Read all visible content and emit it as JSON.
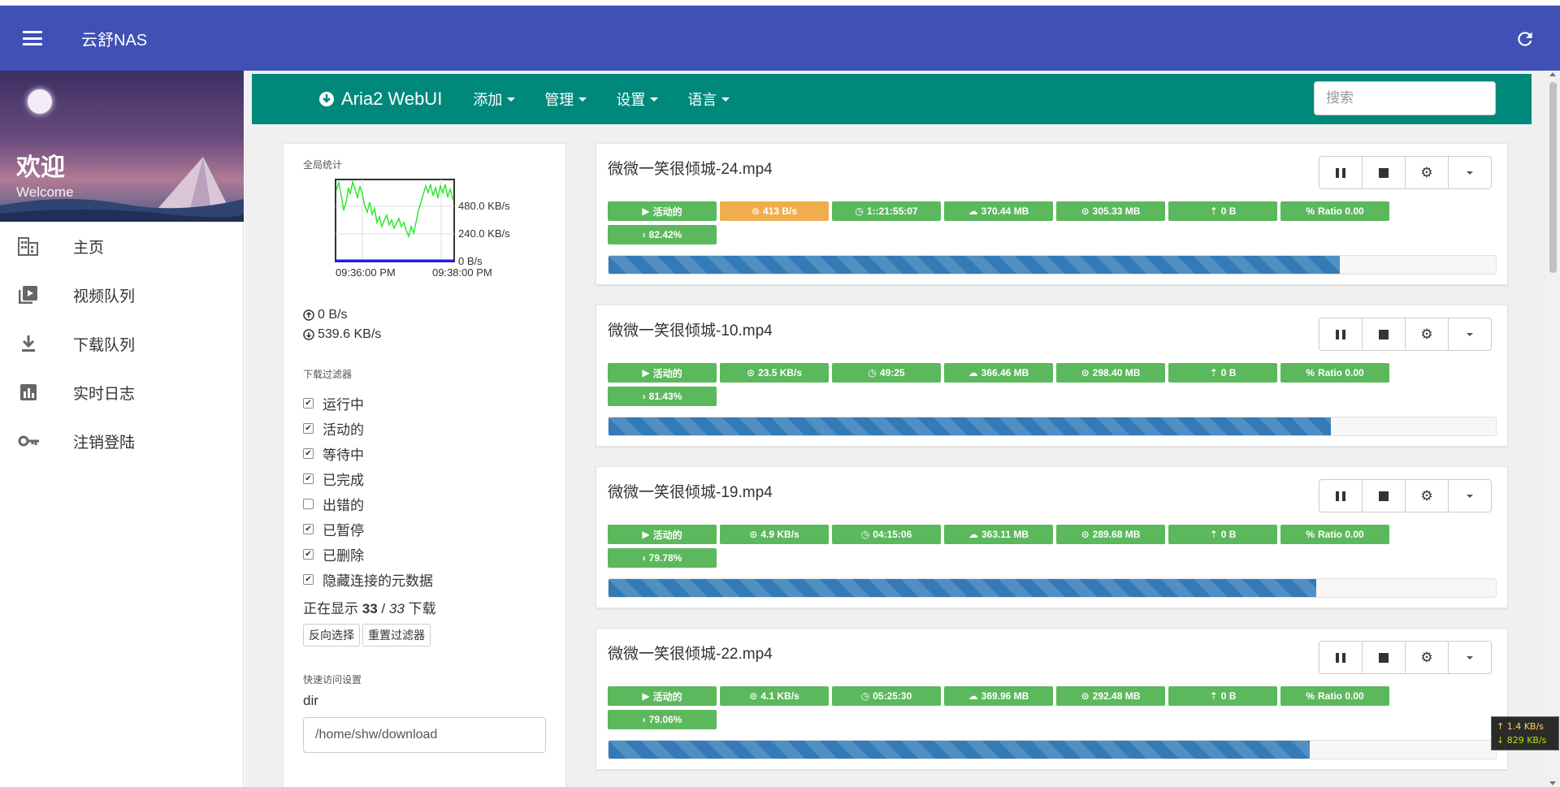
{
  "app": {
    "title": "云舒NAS"
  },
  "drawer": {
    "welcome_cn": "欢迎",
    "welcome_en": "Welcome",
    "items": [
      {
        "label": "主页",
        "icon": "building-icon"
      },
      {
        "label": "视频队列",
        "icon": "video-queue-icon"
      },
      {
        "label": "下载队列",
        "icon": "download-icon"
      },
      {
        "label": "实时日志",
        "icon": "chart-icon"
      },
      {
        "label": "注销登陆",
        "icon": "key-icon"
      }
    ]
  },
  "topnav": {
    "brand": "Aria2 WebUI",
    "menu": [
      "添加",
      "管理",
      "设置",
      "语言"
    ],
    "search_placeholder": "搜索",
    "color": "#00897b"
  },
  "stats": {
    "title": "全局统计",
    "y_labels": [
      "480.0 KB/s",
      "240.0 KB/s",
      "0 B/s"
    ],
    "x_labels": [
      "09:36:00 PM",
      "09:38:00 PM"
    ],
    "upload": "0 B/s",
    "download": "539.6 KB/s",
    "filter_title": "下载过滤器",
    "filters": [
      {
        "label": "运行中",
        "checked": true
      },
      {
        "label": "活动的",
        "checked": true
      },
      {
        "label": "等待中",
        "checked": true
      },
      {
        "label": "已完成",
        "checked": true
      },
      {
        "label": "出错的",
        "checked": false
      },
      {
        "label": "已暂停",
        "checked": true
      },
      {
        "label": "已删除",
        "checked": true
      },
      {
        "label": "隐藏连接的元数据",
        "checked": true
      }
    ],
    "showing_prefix": "正在显示",
    "showing_count": "33",
    "showing_sep": "/",
    "showing_total": "33",
    "showing_suffix": "下载",
    "btn_invert": "反向选择",
    "btn_reset": "重置过滤器",
    "quick_title": "快速访问设置",
    "dir_label": "dir",
    "dir_value": "/home/shw/download"
  },
  "downloads": [
    {
      "name": "微微一笑很倾城-24.mp4",
      "status": "活动的",
      "speed": "413 B/s",
      "speed_warn": true,
      "eta": "1::21:55:07",
      "size": "370.44 MB",
      "downloaded": "305.33 MB",
      "upload": "0 B",
      "ratio": "Ratio 0.00",
      "percent_label": "82.42%",
      "percent": 82.42
    },
    {
      "name": "微微一笑很倾城-10.mp4",
      "status": "活动的",
      "speed": "23.5 KB/s",
      "speed_warn": false,
      "eta": "49:25",
      "size": "366.46 MB",
      "downloaded": "298.40 MB",
      "upload": "0 B",
      "ratio": "Ratio 0.00",
      "percent_label": "81.43%",
      "percent": 81.43
    },
    {
      "name": "微微一笑很倾城-19.mp4",
      "status": "活动的",
      "speed": "4.9 KB/s",
      "speed_warn": false,
      "eta": "04:15:06",
      "size": "363.11 MB",
      "downloaded": "289.68 MB",
      "upload": "0 B",
      "ratio": "Ratio 0.00",
      "percent_label": "79.78%",
      "percent": 79.78
    },
    {
      "name": "微微一笑很倾城-22.mp4",
      "status": "活动的",
      "speed": "4.1 KB/s",
      "speed_warn": false,
      "eta": "05:25:30",
      "size": "369.96 MB",
      "downloaded": "292.48 MB",
      "upload": "0 B",
      "ratio": "Ratio 0.00",
      "percent_label": "79.06%",
      "percent": 79.06
    }
  ],
  "speed_widget": {
    "up": "↑ 1.4 KB/s",
    "down": "↓ 829 KB/s"
  },
  "colors": {
    "appbar": "#3f51b5",
    "success": "#5cb85c",
    "warning": "#f0ad4e",
    "progress": "#337ab7"
  }
}
